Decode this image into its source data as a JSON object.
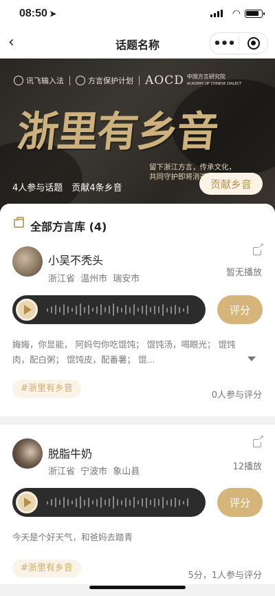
{
  "status_bar": {
    "time": "08:50"
  },
  "nav": {
    "title": "话题名称",
    "more_glyph": "•••"
  },
  "banner": {
    "logos": [
      "讯飞输入法",
      "方言保护计划",
      "AOCD",
      "中国方言研究院",
      "ACADEMY OF CHINESE DIALECT"
    ],
    "headline": "浙里有乡音",
    "slogan_line1": "留下浙江方言，传承文化，",
    "slogan_line2": "共同守护即将消逝的声音。",
    "stats": "4人参与话题　贡献4条乡音",
    "contribute_label": "贡献乡音"
  },
  "library": {
    "title": "全部方言库 (4)"
  },
  "posts": [
    {
      "user": "小吴不秃头",
      "location": "浙江省 温州市 瑞安市",
      "plays": "暂无播放",
      "rate_label": "评分",
      "description": "娒娒，你显能， 阿妈匄你吃馄饨； 馄饨汤，喝眼光； 馄饨肉，配白粥； 馄饨皮，配番薯； 馄...",
      "tag": "#浙里有乡音",
      "rating": "0人参与评分"
    },
    {
      "user": "脱脂牛奶",
      "location": "浙江省 宁波市 象山县",
      "plays": "12播放",
      "rate_label": "评分",
      "description": "今天是个好天气，和爸妈去踏青",
      "tag": "#浙里有乡音",
      "rating": "5分，1人参与评分"
    }
  ],
  "colors": {
    "accent": "#d6b57a",
    "tag_bg": "#faf3e8",
    "player_bg": "#2c2c2c"
  },
  "icons": [
    "location-arrow-icon",
    "signal-icon",
    "wifi-icon",
    "battery-icon",
    "back-icon",
    "more-icon",
    "target-icon",
    "library-icon",
    "share-icon",
    "play-icon",
    "expand-icon"
  ]
}
